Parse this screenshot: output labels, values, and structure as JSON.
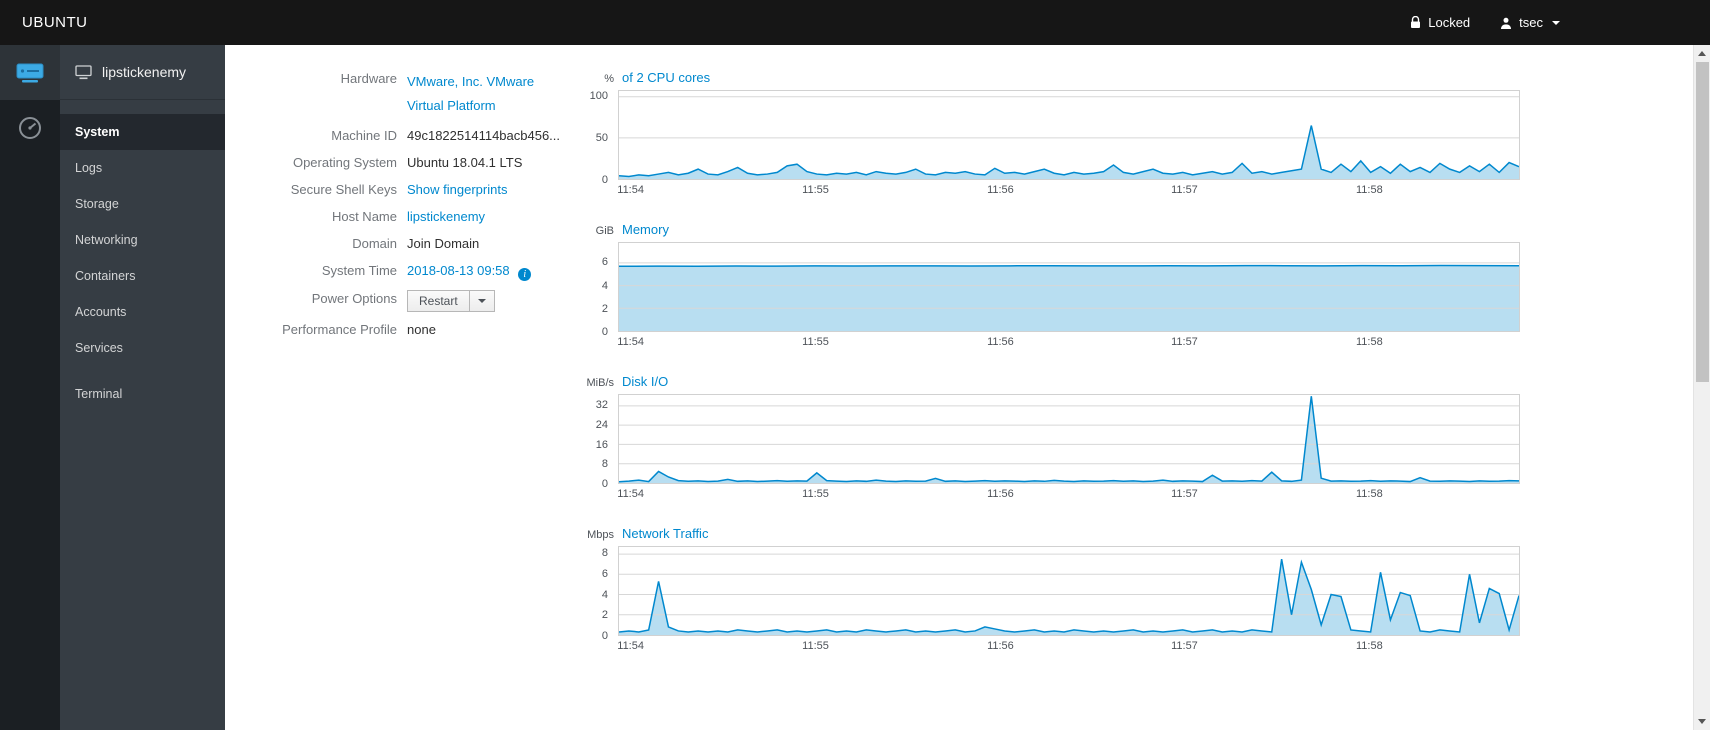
{
  "colors": {
    "link": "#0088ce",
    "chart_line": "#0088ce",
    "chart_fill": "rgba(0,136,206,0.28)",
    "grid": "#d7d7d7",
    "topbar_bg": "#161616",
    "sidebar_bg": "#363d44"
  },
  "topbar": {
    "brand": "UBUNTU",
    "locked_label": "Locked",
    "user_name": "tsec"
  },
  "sidebar": {
    "host_name": "lipstickenemy",
    "items": [
      {
        "label": "System",
        "active": true
      },
      {
        "label": "Logs",
        "active": false
      },
      {
        "label": "Storage",
        "active": false
      },
      {
        "label": "Networking",
        "active": false
      },
      {
        "label": "Containers",
        "active": false
      },
      {
        "label": "Accounts",
        "active": false
      },
      {
        "label": "Services",
        "active": false
      },
      {
        "label": "Terminal",
        "active": false
      }
    ]
  },
  "details": {
    "hardware_label": "Hardware",
    "hardware_value": "VMware, Inc. VMware Virtual Platform",
    "machine_id_label": "Machine ID",
    "machine_id_value": "49c1822514114bacb456...",
    "os_label": "Operating System",
    "os_value": "Ubuntu 18.04.1 LTS",
    "ssh_label": "Secure Shell Keys",
    "ssh_value": "Show fingerprints",
    "hostname_label": "Host Name",
    "hostname_value": "lipstickenemy",
    "domain_label": "Domain",
    "domain_value": "Join Domain",
    "time_label": "System Time",
    "time_value": "2018-08-13 09:58",
    "power_label": "Power Options",
    "power_button": "Restart",
    "profile_label": "Performance Profile",
    "profile_value": "none"
  },
  "chart_data": [
    {
      "type": "area",
      "unit": "%",
      "title": "of 2 CPU cores",
      "ylabel": "% of 2 CPU cores",
      "yticks": [
        0,
        50,
        100
      ],
      "ylim": [
        0,
        107
      ],
      "xticks": [
        "11:54",
        "11:55",
        "11:56",
        "11:57",
        "11:58"
      ],
      "xtick_pos": [
        0.014,
        0.219,
        0.424,
        0.628,
        0.833
      ],
      "values": [
        4,
        3,
        5,
        4,
        6,
        8,
        5,
        7,
        12,
        6,
        5,
        9,
        14,
        7,
        5,
        6,
        8,
        16,
        18,
        9,
        6,
        5,
        7,
        6,
        8,
        5,
        9,
        7,
        6,
        8,
        12,
        6,
        5,
        8,
        7,
        9,
        6,
        5,
        13,
        7,
        8,
        6,
        9,
        12,
        7,
        5,
        8,
        6,
        7,
        9,
        17,
        8,
        6,
        9,
        12,
        7,
        6,
        8,
        5,
        7,
        9,
        6,
        8,
        19,
        7,
        9,
        6,
        8,
        10,
        12,
        65,
        12,
        8,
        18,
        9,
        22,
        8,
        15,
        7,
        18,
        9,
        14,
        8,
        19,
        12,
        8,
        16,
        9,
        18,
        8,
        20,
        15
      ]
    },
    {
      "type": "area",
      "unit": "GiB",
      "title": "Memory",
      "ylabel": "GiB Memory",
      "yticks": [
        0,
        2,
        4,
        6
      ],
      "ylim": [
        0,
        7.75
      ],
      "xticks": [
        "11:54",
        "11:55",
        "11:56",
        "11:57",
        "11:58"
      ],
      "xtick_pos": [
        0.014,
        0.219,
        0.424,
        0.628,
        0.833
      ],
      "values": [
        5.7,
        5.71,
        5.7,
        5.72,
        5.71,
        5.73,
        5.72,
        5.74,
        5.73,
        5.72,
        5.74,
        5.75,
        5.74,
        5.73,
        5.75,
        5.74,
        5.76,
        5.75,
        5.74,
        5.76,
        5.75,
        5.77,
        5.76,
        5.75
      ]
    },
    {
      "type": "area",
      "unit": "MiB/s",
      "title": "Disk I/O",
      "ylabel": "MiB/s Disk I/O",
      "yticks": [
        0,
        8,
        16,
        24,
        32
      ],
      "ylim": [
        0,
        36.5
      ],
      "xticks": [
        "11:54",
        "11:55",
        "11:56",
        "11:57",
        "11:58"
      ],
      "xtick_pos": [
        0.014,
        0.219,
        0.424,
        0.628,
        0.833
      ],
      "values": [
        0.5,
        0.8,
        1.2,
        0.6,
        4.8,
        2.5,
        1.0,
        0.7,
        0.9,
        0.6,
        0.8,
        1.5,
        0.7,
        0.9,
        0.6,
        0.8,
        1.0,
        0.7,
        0.9,
        0.8,
        4.2,
        1.0,
        0.8,
        0.6,
        0.9,
        0.7,
        1.2,
        0.8,
        0.6,
        0.9,
        0.7,
        0.8,
        1.9,
        0.7,
        0.9,
        0.6,
        0.8,
        1.0,
        0.7,
        0.9,
        0.8,
        0.6,
        0.9,
        0.7,
        1.1,
        0.8,
        0.6,
        0.9,
        0.7,
        0.8,
        1.0,
        0.7,
        0.9,
        0.6,
        0.8,
        1.2,
        0.7,
        0.9,
        0.8,
        0.6,
        3.2,
        0.8,
        0.9,
        0.7,
        1.0,
        0.8,
        4.5,
        0.9,
        0.7,
        1.2,
        36,
        2.0,
        0.8,
        0.9,
        0.7,
        0.8,
        1.0,
        0.7,
        0.9,
        0.8,
        0.6,
        2.2,
        0.8,
        0.7,
        0.9,
        0.8,
        0.6,
        0.9,
        0.7,
        0.8,
        1.0,
        0.9
      ]
    },
    {
      "type": "area",
      "unit": "Mbps",
      "title": "Network Traffic",
      "ylabel": "Mbps Network Traffic",
      "yticks": [
        0,
        2,
        4,
        6,
        8
      ],
      "ylim": [
        0,
        8.7
      ],
      "xticks": [
        "11:54",
        "11:55",
        "11:56",
        "11:57",
        "11:58"
      ],
      "xtick_pos": [
        0.014,
        0.219,
        0.424,
        0.628,
        0.833
      ],
      "values": [
        0.3,
        0.4,
        0.3,
        0.5,
        5.3,
        0.8,
        0.4,
        0.3,
        0.4,
        0.3,
        0.4,
        0.3,
        0.5,
        0.4,
        0.3,
        0.4,
        0.5,
        0.3,
        0.4,
        0.3,
        0.4,
        0.5,
        0.3,
        0.4,
        0.3,
        0.5,
        0.4,
        0.3,
        0.4,
        0.5,
        0.3,
        0.4,
        0.3,
        0.4,
        0.5,
        0.3,
        0.4,
        0.8,
        0.6,
        0.4,
        0.3,
        0.4,
        0.5,
        0.3,
        0.4,
        0.3,
        0.5,
        0.4,
        0.3,
        0.4,
        0.3,
        0.4,
        0.5,
        0.3,
        0.4,
        0.3,
        0.4,
        0.5,
        0.3,
        0.4,
        0.5,
        0.3,
        0.4,
        0.3,
        0.5,
        0.4,
        0.3,
        7.5,
        2.0,
        7.2,
        4.5,
        1.0,
        4.0,
        3.8,
        0.5,
        0.4,
        0.3,
        6.2,
        1.5,
        4.2,
        3.9,
        0.4,
        0.3,
        0.5,
        0.4,
        0.3,
        6.0,
        1.2,
        4.6,
        4.1,
        0.5,
        3.9
      ]
    }
  ]
}
